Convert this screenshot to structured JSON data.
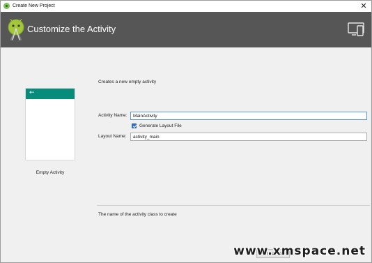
{
  "window": {
    "title": "Create New Project",
    "close_glyph": "✕"
  },
  "header": {
    "title": "Customize the Activity",
    "logo_icon": "android-studio-logo-icon",
    "device_icon": "device-preview-icon"
  },
  "preview": {
    "caption": "Empty Activity",
    "back_glyph": "←",
    "toolbar_color": "#078c7c"
  },
  "form": {
    "description": "Creates a new empty activity",
    "activity_name_label": "Activity Name:",
    "activity_name_value": "MainActivity",
    "generate_layout_label": "Generate Layout File",
    "generate_layout_checked": true,
    "layout_name_label": "Layout Name:",
    "layout_name_value": "activity_main"
  },
  "hint": "The name of the activity class to create",
  "footer": {
    "button_label": "Previous"
  },
  "watermark": "www.xmspace.net",
  "colors": {
    "header_bg": "#565656",
    "accent": "#078c7c",
    "checkbox": "#2f6fd1"
  }
}
